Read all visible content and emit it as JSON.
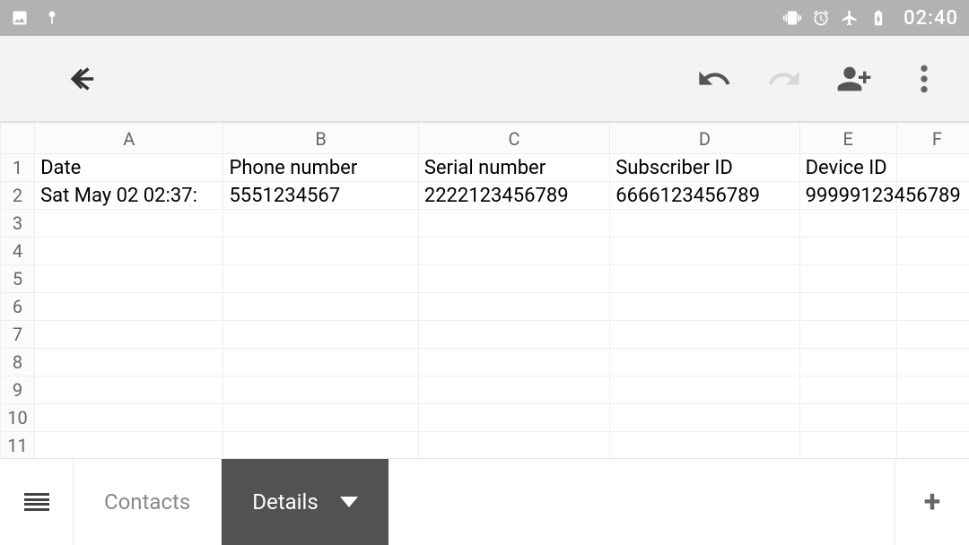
{
  "status": {
    "time": "02:40"
  },
  "columns": {
    "A": "A",
    "B": "B",
    "C": "C",
    "D": "D",
    "E": "E",
    "F": "F"
  },
  "row_labels": {
    "1": "1",
    "2": "2",
    "3": "3",
    "4": "4",
    "5": "5",
    "6": "6",
    "7": "7",
    "8": "8",
    "9": "9",
    "10": "10",
    "11": "11"
  },
  "cells": {
    "A1": "Date",
    "B1": "Phone number",
    "C1": "Serial number",
    "D1": "Subscriber ID",
    "E1": "Device ID",
    "A2": "Sat May 02 02:37:",
    "B2": "5551234567",
    "C2": "2222123456789",
    "D2": "6666123456789",
    "E2": "99999123456789"
  },
  "tabs": {
    "contacts": "Contacts",
    "details": "Details"
  }
}
